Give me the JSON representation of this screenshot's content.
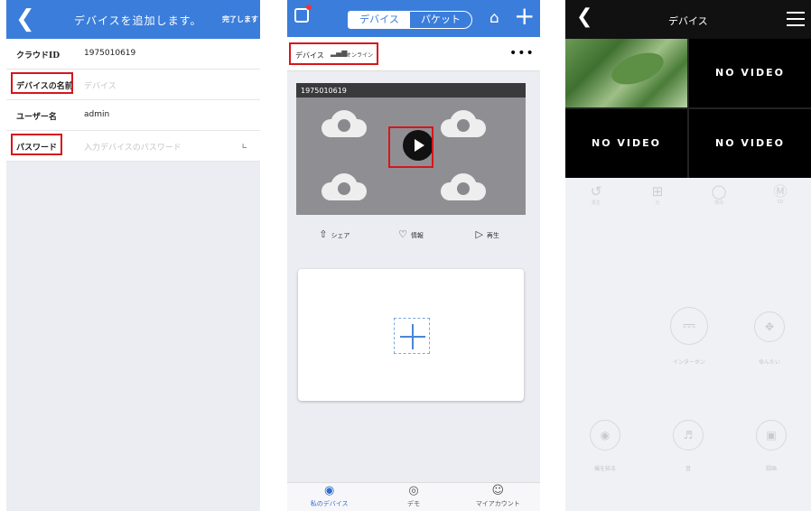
{
  "panel1": {
    "header": {
      "title": "デバイスを追加します。",
      "done": "完了します"
    },
    "rows": [
      {
        "label": "クラウドID",
        "value": "1975010619",
        "placeholder": ""
      },
      {
        "label": "デバイスの名前",
        "value": "",
        "placeholder": "デバイス"
      },
      {
        "label": "ユーザー名",
        "value": "admin",
        "placeholder": ""
      },
      {
        "label": "パスワード",
        "value": "",
        "placeholder": "入力デバイスのパスワード"
      }
    ]
  },
  "panel2": {
    "segment": {
      "device": "デバイス",
      "packet": "パケット"
    },
    "device": {
      "name": "デバイス",
      "status": "オンライン",
      "id": "1975010619"
    },
    "actions": {
      "share": "シェア",
      "info": "情報",
      "play": "再生"
    },
    "tabs": {
      "my_devices": "私のデバイス",
      "demo": "デモ",
      "my_account": "マイアカウント"
    }
  },
  "panel3": {
    "title": "デバイス",
    "no_video": "NO VIDEO",
    "tools": [
      "再生",
      "分",
      "検出",
      "SD"
    ],
    "controls": {
      "intercom": "インターホン",
      "ptz": "ゆんたい",
      "snapshot": "撮を知る",
      "sound": "音",
      "record": "録画"
    }
  },
  "colors": {
    "blue": "#3b7ddb",
    "highlight": "#d6161b"
  }
}
